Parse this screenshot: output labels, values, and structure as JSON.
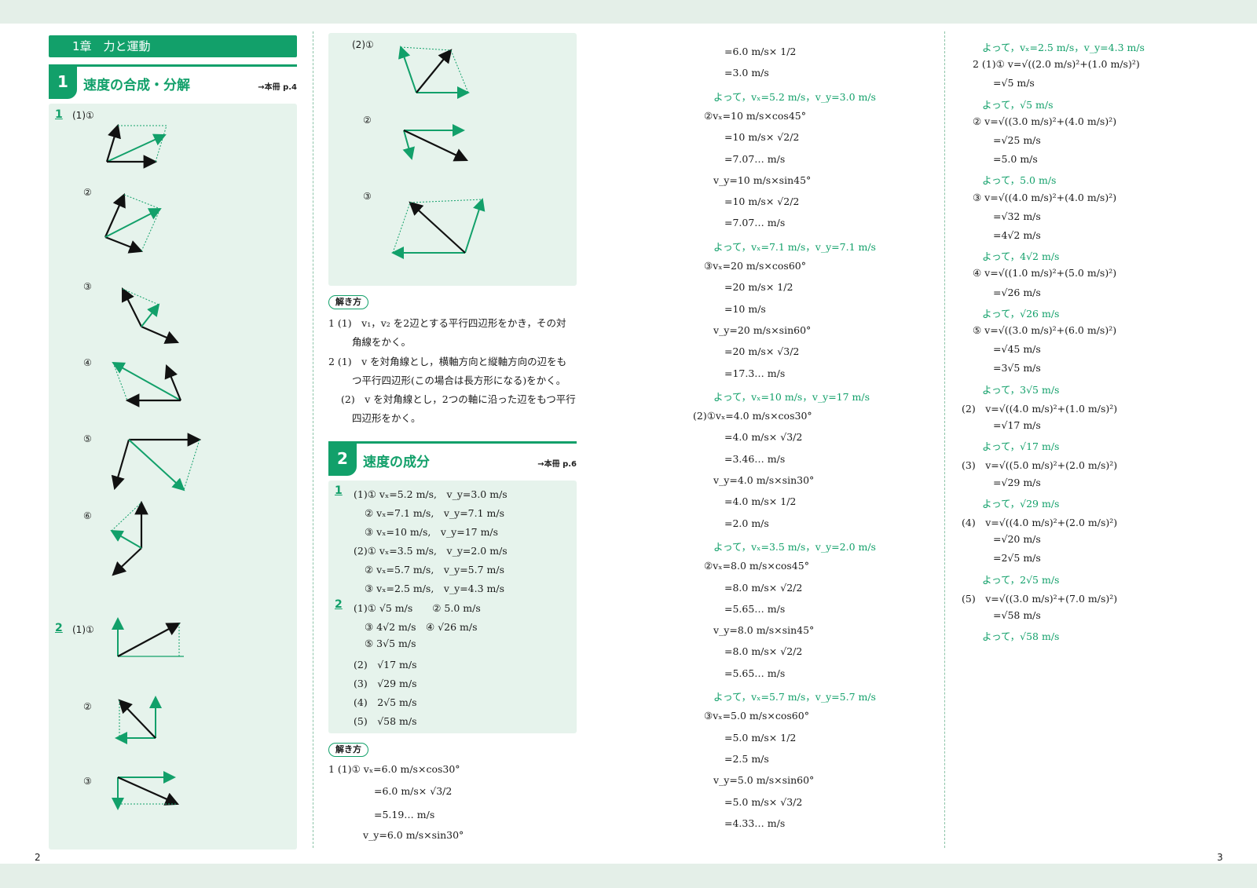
{
  "header": {
    "chapter": "1章　力と運動",
    "section1_number": "1",
    "section1_title": "速度の合成・分解",
    "section1_ref": "→本冊 p.4",
    "section2_number": "2",
    "section2_title": "速度の成分",
    "section2_ref": "→本冊 p.6"
  },
  "left_figures": {
    "p1": "1",
    "p2": "2",
    "labels_p1": [
      "(1)①",
      "②",
      "③",
      "④",
      "⑤",
      "⑥"
    ],
    "labels_p2": [
      "(1)①",
      "②",
      "③"
    ],
    "labels_p2_2": [
      "(2)①",
      "②",
      "③"
    ]
  },
  "explanation1": {
    "pill": "解き方",
    "lines": [
      "1 (1)　v₁，v₂ を2辺とする平行四辺形をかき，その対",
      "角線をかく。",
      "2 (1)　v を対角線とし，横軸方向と縦軸方向の辺をも",
      "つ平行四辺形(この場合は長方形になる)をかく。",
      "(2)　v を対角線とし，2つの軸に沿った辺をもつ平行",
      "四辺形をかく。"
    ]
  },
  "answers2": {
    "p1": "1",
    "p2": "2",
    "lines1": [
      "(1)① vₓ=5.2 m/s,　v_y=3.0 m/s",
      "② vₓ=7.1 m/s,　v_y=7.1 m/s",
      "③ vₓ=10 m/s,　v_y=17 m/s",
      "(2)① vₓ=3.5 m/s,　v_y=2.0 m/s",
      "② vₓ=5.7 m/s,　v_y=5.7 m/s",
      "③ vₓ=2.5 m/s,　v_y=4.3 m/s"
    ],
    "lines2": [
      "(1)① √5 m/s　　② 5.0 m/s",
      "③ 4√2 m/s　④ √26 m/s",
      "⑤ 3√5 m/s",
      "(2)　√17 m/s",
      "(3)　√29 m/s",
      "(4)　2√5 m/s",
      "(5)　√58 m/s"
    ]
  },
  "explanation2": {
    "pill": "解き方",
    "lines": [
      "1 (1)① vₓ=6.0 m/s×cos30°",
      "=6.0 m/s× √3/2",
      "=5.19… m/s",
      "v_y=6.0 m/s×sin30°"
    ]
  },
  "column3": [
    {
      "t": "=6.0 m/s× 1/2",
      "g": false
    },
    {
      "t": "=3.0 m/s",
      "g": false
    },
    {
      "t": "よって，vₓ=5.2 m/s，v_y=3.0 m/s",
      "g": true
    },
    {
      "t": "②vₓ=10 m/s×cos45°",
      "g": false
    },
    {
      "t": "=10 m/s× √2/2",
      "g": false
    },
    {
      "t": "=7.07… m/s",
      "g": false
    },
    {
      "t": "v_y=10 m/s×sin45°",
      "g": false
    },
    {
      "t": "=10 m/s× √2/2",
      "g": false
    },
    {
      "t": "=7.07… m/s",
      "g": false
    },
    {
      "t": "よって，vₓ=7.1 m/s，v_y=7.1 m/s",
      "g": true
    },
    {
      "t": "③vₓ=20 m/s×cos60°",
      "g": false
    },
    {
      "t": "=20 m/s× 1/2",
      "g": false
    },
    {
      "t": "=10 m/s",
      "g": false
    },
    {
      "t": "v_y=20 m/s×sin60°",
      "g": false
    },
    {
      "t": "=20 m/s× √3/2",
      "g": false
    },
    {
      "t": "=17.3… m/s",
      "g": false
    },
    {
      "t": "よって，vₓ=10 m/s，v_y=17 m/s",
      "g": true
    },
    {
      "t": "(2)①vₓ=4.0 m/s×cos30°",
      "g": false
    },
    {
      "t": "=4.0 m/s× √3/2",
      "g": false
    },
    {
      "t": "=3.46… m/s",
      "g": false
    },
    {
      "t": "v_y=4.0 m/s×sin30°",
      "g": false
    },
    {
      "t": "=4.0 m/s× 1/2",
      "g": false
    },
    {
      "t": "=2.0 m/s",
      "g": false
    },
    {
      "t": "よって，vₓ=3.5 m/s，v_y=2.0 m/s",
      "g": true
    },
    {
      "t": "②vₓ=8.0 m/s×cos45°",
      "g": false
    },
    {
      "t": "=8.0 m/s× √2/2",
      "g": false
    },
    {
      "t": "=5.65… m/s",
      "g": false
    },
    {
      "t": "v_y=8.0 m/s×sin45°",
      "g": false
    },
    {
      "t": "=8.0 m/s× √2/2",
      "g": false
    },
    {
      "t": "=5.65… m/s",
      "g": false
    },
    {
      "t": "よって，vₓ=5.7 m/s，v_y=5.7 m/s",
      "g": true
    },
    {
      "t": "③vₓ=5.0 m/s×cos60°",
      "g": false
    },
    {
      "t": "=5.0 m/s× 1/2",
      "g": false
    },
    {
      "t": "=2.5 m/s",
      "g": false
    },
    {
      "t": "v_y=5.0 m/s×sin60°",
      "g": false
    },
    {
      "t": "=5.0 m/s× √3/2",
      "g": false
    },
    {
      "t": "=4.33… m/s",
      "g": false
    }
  ],
  "column4": [
    {
      "t": "よって，vₓ=2.5 m/s，v_y=4.3 m/s",
      "g": true
    },
    {
      "t": "2 (1)① v=√((2.0 m/s)²+(1.0 m/s)²)",
      "g": false
    },
    {
      "t": "=√5 m/s",
      "g": false
    },
    {
      "t": "よって，√5 m/s",
      "g": true
    },
    {
      "t": "② v=√((3.0 m/s)²+(4.0 m/s)²)",
      "g": false
    },
    {
      "t": "=√25 m/s",
      "g": false
    },
    {
      "t": "=5.0 m/s",
      "g": false
    },
    {
      "t": "よって，5.0 m/s",
      "g": true
    },
    {
      "t": "③ v=√((4.0 m/s)²+(4.0 m/s)²)",
      "g": false
    },
    {
      "t": "=√32 m/s",
      "g": false
    },
    {
      "t": "=4√2 m/s",
      "g": false
    },
    {
      "t": "よって，4√2 m/s",
      "g": true
    },
    {
      "t": "④ v=√((1.0 m/s)²+(5.0 m/s)²)",
      "g": false
    },
    {
      "t": "=√26 m/s",
      "g": false
    },
    {
      "t": "よって，√26 m/s",
      "g": true
    },
    {
      "t": "⑤ v=√((3.0 m/s)²+(6.0 m/s)²)",
      "g": false
    },
    {
      "t": "=√45 m/s",
      "g": false
    },
    {
      "t": "=3√5 m/s",
      "g": false
    },
    {
      "t": "よって，3√5 m/s",
      "g": true
    },
    {
      "t": "(2)　v=√((4.0 m/s)²+(1.0 m/s)²)",
      "g": false
    },
    {
      "t": "=√17 m/s",
      "g": false
    },
    {
      "t": "よって，√17 m/s",
      "g": true
    },
    {
      "t": "(3)　v=√((5.0 m/s)²+(2.0 m/s)²)",
      "g": false
    },
    {
      "t": "=√29 m/s",
      "g": false
    },
    {
      "t": "よって，√29 m/s",
      "g": true
    },
    {
      "t": "(4)　v=√((4.0 m/s)²+(2.0 m/s)²)",
      "g": false
    },
    {
      "t": "=√20 m/s",
      "g": false
    },
    {
      "t": "=2√5 m/s",
      "g": false
    },
    {
      "t": "よって，2√5 m/s",
      "g": true
    },
    {
      "t": "(5)　v=√((3.0 m/s)²+(7.0 m/s)²)",
      "g": false
    },
    {
      "t": "=√58 m/s",
      "g": false
    },
    {
      "t": "よって，√58 m/s",
      "g": true
    }
  ],
  "page_numbers": {
    "left": "2",
    "right": "3"
  },
  "colors": {
    "accent": "#12a06a",
    "panel": "#e6f3ec",
    "band": "#e4efe8"
  }
}
